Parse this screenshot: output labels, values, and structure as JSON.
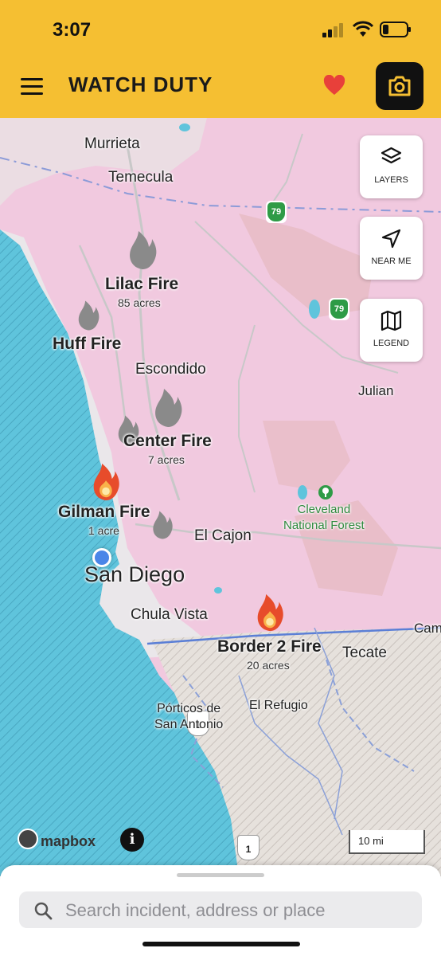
{
  "status_bar": {
    "time": "3:07"
  },
  "header": {
    "title": "WATCH DUTY"
  },
  "map": {
    "cities": [
      {
        "name": "Murrieta"
      },
      {
        "name": "Temecula"
      },
      {
        "name": "Escondido"
      },
      {
        "name": "Julian"
      },
      {
        "name": "El Cajon"
      },
      {
        "name": "San Diego"
      },
      {
        "name": "Chula Vista"
      },
      {
        "name": "Tecate"
      },
      {
        "name": "Cam"
      },
      {
        "name": "El Refugio"
      },
      {
        "name": "Pórticos de\nSan Antonio"
      }
    ],
    "forest": "Cleveland\nNational Forest",
    "fires": [
      {
        "name": "Lilac Fire",
        "acres": "85 acres",
        "active": false
      },
      {
        "name": "Huff Fire",
        "acres": "",
        "active": false
      },
      {
        "name": "Center Fire",
        "acres": "7 acres",
        "active": false
      },
      {
        "name": "Gilman Fire",
        "acres": "1 acre",
        "active": true
      },
      {
        "name": "Border 2 Fire",
        "acres": "20 acres",
        "active": true
      }
    ],
    "route_shields": [
      "79",
      "79",
      "1",
      "1"
    ],
    "controls": [
      {
        "label": "LAYERS",
        "icon": "layers-icon"
      },
      {
        "label": "NEAR ME",
        "icon": "navigation-arrow-icon"
      },
      {
        "label": "LEGEND",
        "icon": "map-legend-icon"
      }
    ],
    "attribution": "mapbox",
    "scale_label": "10 mi"
  },
  "search": {
    "placeholder": "Search incident, address or place"
  },
  "colors": {
    "brand": "#f5bf32",
    "fire_active": "#e74c2b",
    "fire_inactive": "#8a8a8a",
    "land": "#f1c9df",
    "ocean": "#63c5dc"
  }
}
